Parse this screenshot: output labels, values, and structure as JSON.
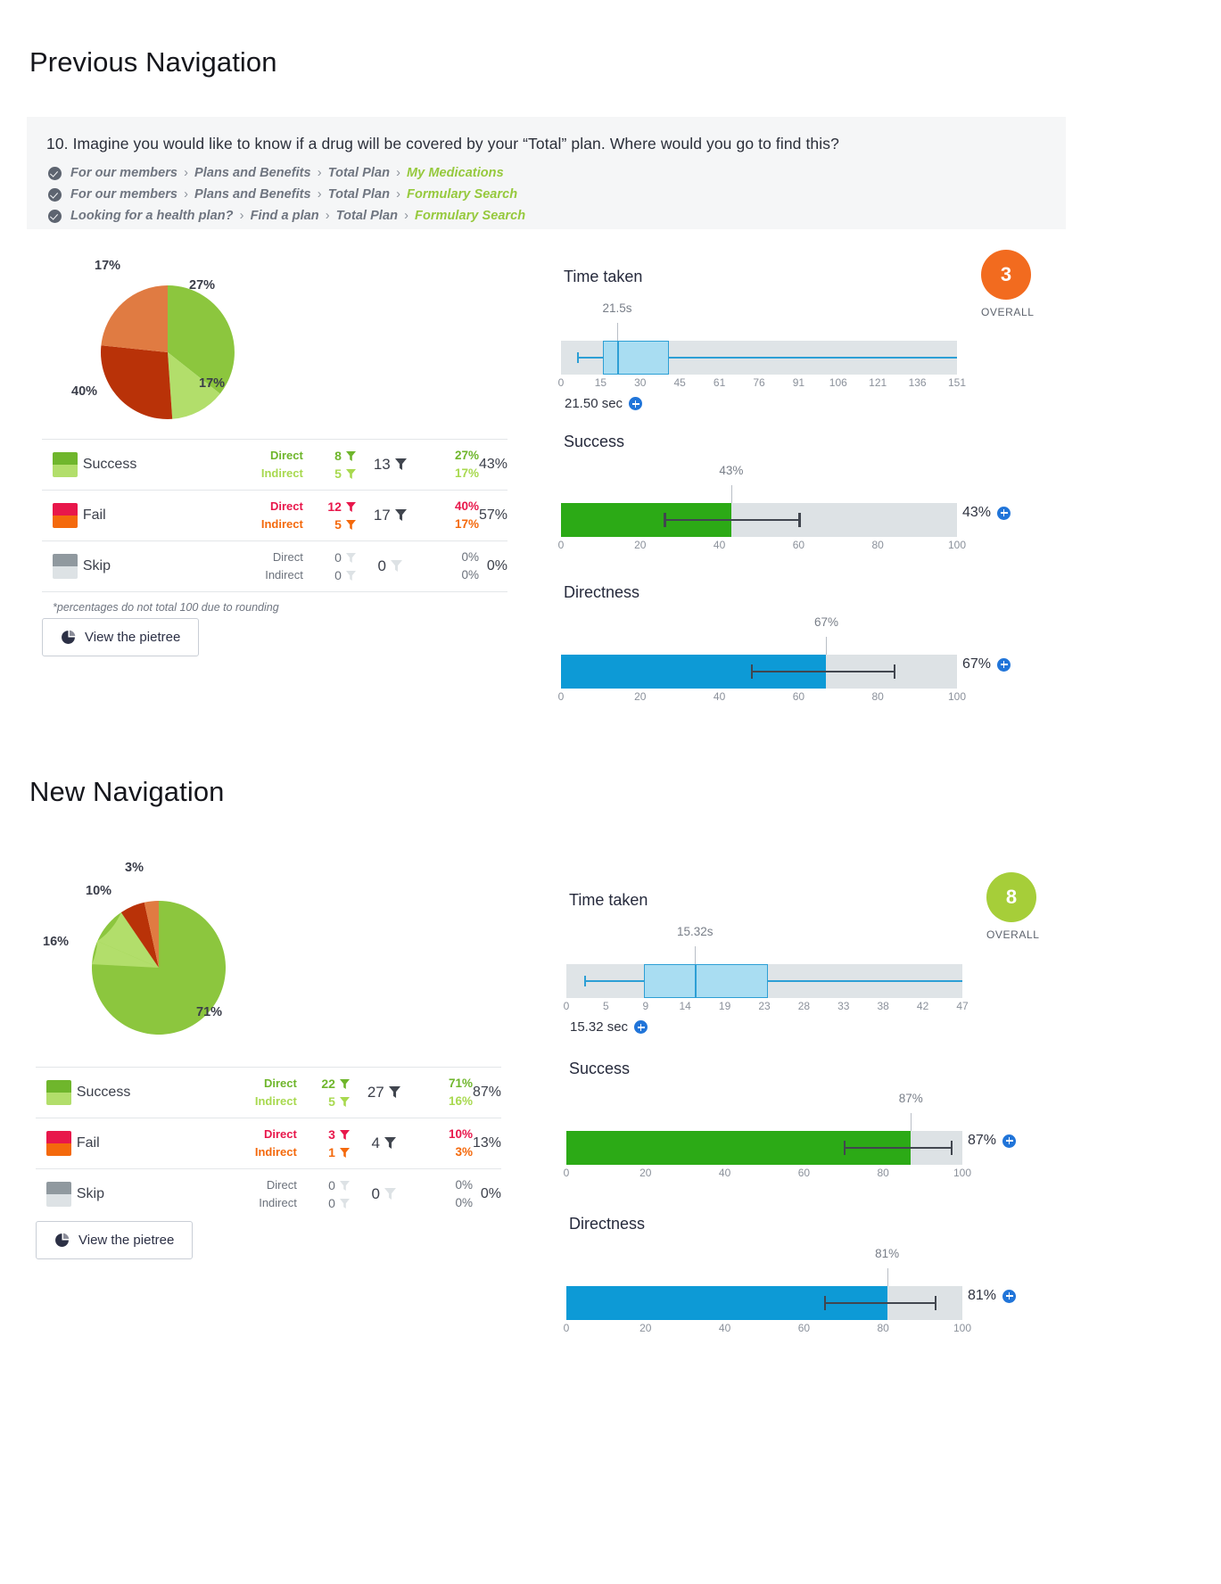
{
  "sections": [
    {
      "heading": "Previous Navigation",
      "question": {
        "text": "10. Imagine you would like to know if a drug will be covered by your “Total” plan. Where would you go to find this?",
        "paths": [
          {
            "crumbs": [
              "For our members",
              "Plans and Benefits",
              "Total Plan"
            ],
            "last": "My Medications"
          },
          {
            "crumbs": [
              "For our members",
              "Plans and Benefits",
              "Total Plan"
            ],
            "last": "Formulary Search"
          },
          {
            "crumbs": [
              "Looking for a health plan?",
              "Find a plan",
              "Total Plan"
            ],
            "last": "Formulary Search"
          }
        ]
      },
      "pie": {
        "type": "pie",
        "title": "",
        "slices": [
          {
            "label": "27%",
            "value": 27,
            "color": "#8cc63e",
            "name": "Success direct"
          },
          {
            "label": "17%",
            "value": 17,
            "color": "#b2de6b",
            "name": "Success indirect"
          },
          {
            "label": "40%",
            "value": 40,
            "color": "#b93208",
            "name": "Fail direct"
          },
          {
            "label": "17%",
            "value": 17,
            "color": "#e07b42",
            "name": "Fail indirect"
          }
        ]
      },
      "table": {
        "rows": [
          {
            "label": "Success",
            "swatch_top": "#6fb62c",
            "swatch_bottom": "#b2de6b",
            "direct_label": "Direct",
            "indirect_label": "Indirect",
            "direct_count": "8",
            "indirect_count": "5",
            "total_count": "13",
            "direct_pct": "27%",
            "indirect_pct": "17%",
            "total_pct": "43%",
            "direct_color": "#6fb62c",
            "indirect_color": "#a8d94f",
            "has_funnel": true
          },
          {
            "label": "Fail",
            "swatch_top": "#e8174b",
            "swatch_bottom": "#f4690c",
            "direct_label": "Direct",
            "indirect_label": "Indirect",
            "direct_count": "12",
            "indirect_count": "5",
            "total_count": "17",
            "direct_pct": "40%",
            "indirect_pct": "17%",
            "total_pct": "57%",
            "direct_color": "#e8174b",
            "indirect_color": "#f4690c",
            "has_funnel": true
          },
          {
            "label": "Skip",
            "swatch_top": "#90999f",
            "swatch_bottom": "#dde2e5",
            "direct_label": "Direct",
            "indirect_label": "Indirect",
            "direct_count": "0",
            "indirect_count": "0",
            "total_count": "0",
            "direct_pct": "0%",
            "indirect_pct": "0%",
            "total_pct": "0%",
            "direct_color": "#8b919b",
            "indirect_color": "#8b919b",
            "has_funnel": false
          }
        ],
        "footnote": "*percentages do not total 100 due to rounding"
      },
      "pietree_button": "View the pietree",
      "badge": {
        "value": "3",
        "caption": "OVERALL",
        "color": "#f26b1f"
      },
      "time_taken": {
        "title": "Time taken",
        "type": "box",
        "marker_label": "21.5s",
        "marker_value": 21.5,
        "value_text": "21.50 sec",
        "axis_ticks": [
          "0",
          "15",
          "30",
          "45",
          "61",
          "76",
          "91",
          "106",
          "121",
          "136",
          "151"
        ],
        "axis_min": 0,
        "axis_max": 151,
        "whisker_low": 6,
        "q1": 16,
        "median": 21.5,
        "q3": 41,
        "whisker_high": 151
      },
      "success": {
        "title": "Success",
        "type": "bar",
        "marker_label": "43%",
        "value": 43,
        "value_text": "43%",
        "err_low": 26,
        "err_high": 60,
        "bar_color": "#2caa16",
        "axis_ticks": [
          "0",
          "20",
          "40",
          "60",
          "80",
          "100"
        ],
        "axis_min": 0,
        "axis_max": 100
      },
      "directness": {
        "title": "Directness",
        "type": "bar",
        "marker_label": "67%",
        "value": 67,
        "value_text": "67%",
        "err_low": 48,
        "err_high": 84,
        "bar_color": "#0d9ad6",
        "axis_ticks": [
          "0",
          "20",
          "40",
          "60",
          "80",
          "100"
        ],
        "axis_min": 0,
        "axis_max": 100
      }
    },
    {
      "heading": "New Navigation",
      "question": null,
      "pie": {
        "type": "pie",
        "title": "",
        "slices": [
          {
            "label": "71%",
            "value": 71,
            "color": "#8cc63e",
            "name": "Success direct"
          },
          {
            "label": "16%",
            "value": 16,
            "color": "#b2de6b",
            "name": "Success indirect"
          },
          {
            "label": "10%",
            "value": 10,
            "color": "#b93208",
            "name": "Fail direct"
          },
          {
            "label": "3%",
            "value": 3,
            "color": "#e07b42",
            "name": "Fail indirect"
          }
        ]
      },
      "table": {
        "rows": [
          {
            "label": "Success",
            "swatch_top": "#6fb62c",
            "swatch_bottom": "#b2de6b",
            "direct_label": "Direct",
            "indirect_label": "Indirect",
            "direct_count": "22",
            "indirect_count": "5",
            "total_count": "27",
            "direct_pct": "71%",
            "indirect_pct": "16%",
            "total_pct": "87%",
            "direct_color": "#6fb62c",
            "indirect_color": "#a8d94f",
            "has_funnel": true
          },
          {
            "label": "Fail",
            "swatch_top": "#e8174b",
            "swatch_bottom": "#f4690c",
            "direct_label": "Direct",
            "indirect_label": "Indirect",
            "direct_count": "3",
            "indirect_count": "1",
            "total_count": "4",
            "direct_pct": "10%",
            "indirect_pct": "3%",
            "total_pct": "13%",
            "direct_color": "#e8174b",
            "indirect_color": "#f4690c",
            "has_funnel": true
          },
          {
            "label": "Skip",
            "swatch_top": "#90999f",
            "swatch_bottom": "#dde2e5",
            "direct_label": "Direct",
            "indirect_label": "Indirect",
            "direct_count": "0",
            "indirect_count": "0",
            "total_count": "0",
            "direct_pct": "0%",
            "indirect_pct": "0%",
            "total_pct": "0%",
            "direct_color": "#8b919b",
            "indirect_color": "#8b919b",
            "has_funnel": false
          }
        ],
        "footnote": ""
      },
      "pietree_button": "View the pietree",
      "badge": {
        "value": "8",
        "caption": "OVERALL",
        "color": "#a6ce39"
      },
      "time_taken": {
        "title": "Time taken",
        "type": "box",
        "marker_label": "15.32s",
        "marker_value": 15.32,
        "value_text": "15.32 sec",
        "axis_ticks": [
          "0",
          "5",
          "9",
          "14",
          "19",
          "23",
          "28",
          "33",
          "38",
          "42",
          "47"
        ],
        "axis_min": 0,
        "axis_max": 47,
        "whisker_low": 2,
        "q1": 9.2,
        "median": 15.32,
        "q3": 24,
        "whisker_high": 47
      },
      "success": {
        "title": "Success",
        "type": "bar",
        "marker_label": "87%",
        "value": 87,
        "value_text": "87%",
        "err_low": 70,
        "err_high": 97,
        "bar_color": "#2caa16",
        "axis_ticks": [
          "0",
          "20",
          "40",
          "60",
          "80",
          "100"
        ],
        "axis_min": 0,
        "axis_max": 100
      },
      "directness": {
        "title": "Directness",
        "type": "bar",
        "marker_label": "81%",
        "value": 81,
        "value_text": "81%",
        "err_low": 65,
        "err_high": 93,
        "bar_color": "#0d9ad6",
        "axis_ticks": [
          "0",
          "20",
          "40",
          "60",
          "80",
          "100"
        ],
        "axis_min": 0,
        "axis_max": 100
      }
    }
  ]
}
